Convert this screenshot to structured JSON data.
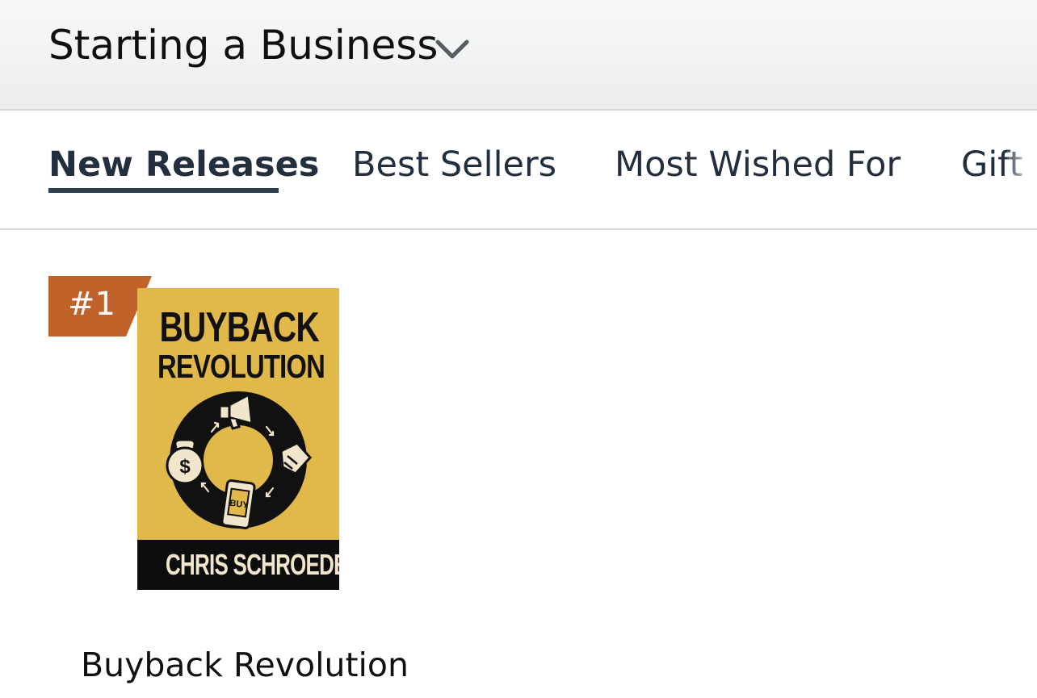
{
  "header": {
    "category_title": "Starting a Business",
    "dropdown_icon": "chevron-down-icon"
  },
  "tabs": [
    {
      "label": "New Releases",
      "active": true
    },
    {
      "label": "Best Sellers",
      "active": false
    },
    {
      "label": "Most Wished For",
      "active": false
    },
    {
      "label": "Gift Ideas",
      "active": false
    }
  ],
  "product": {
    "rank": "#1",
    "cover": {
      "title_line1": "BUYBACK",
      "title_line2": "REVOLUTION",
      "author": "CHRIS SCHROEDER",
      "phone_text": "BUY"
    },
    "title": "Buyback Revolution"
  },
  "colors": {
    "rank_badge": "#c0622a",
    "tab_underline": "#2b3e52",
    "cover_background": "#e1b84a",
    "cover_band": "#0d0d0d"
  }
}
